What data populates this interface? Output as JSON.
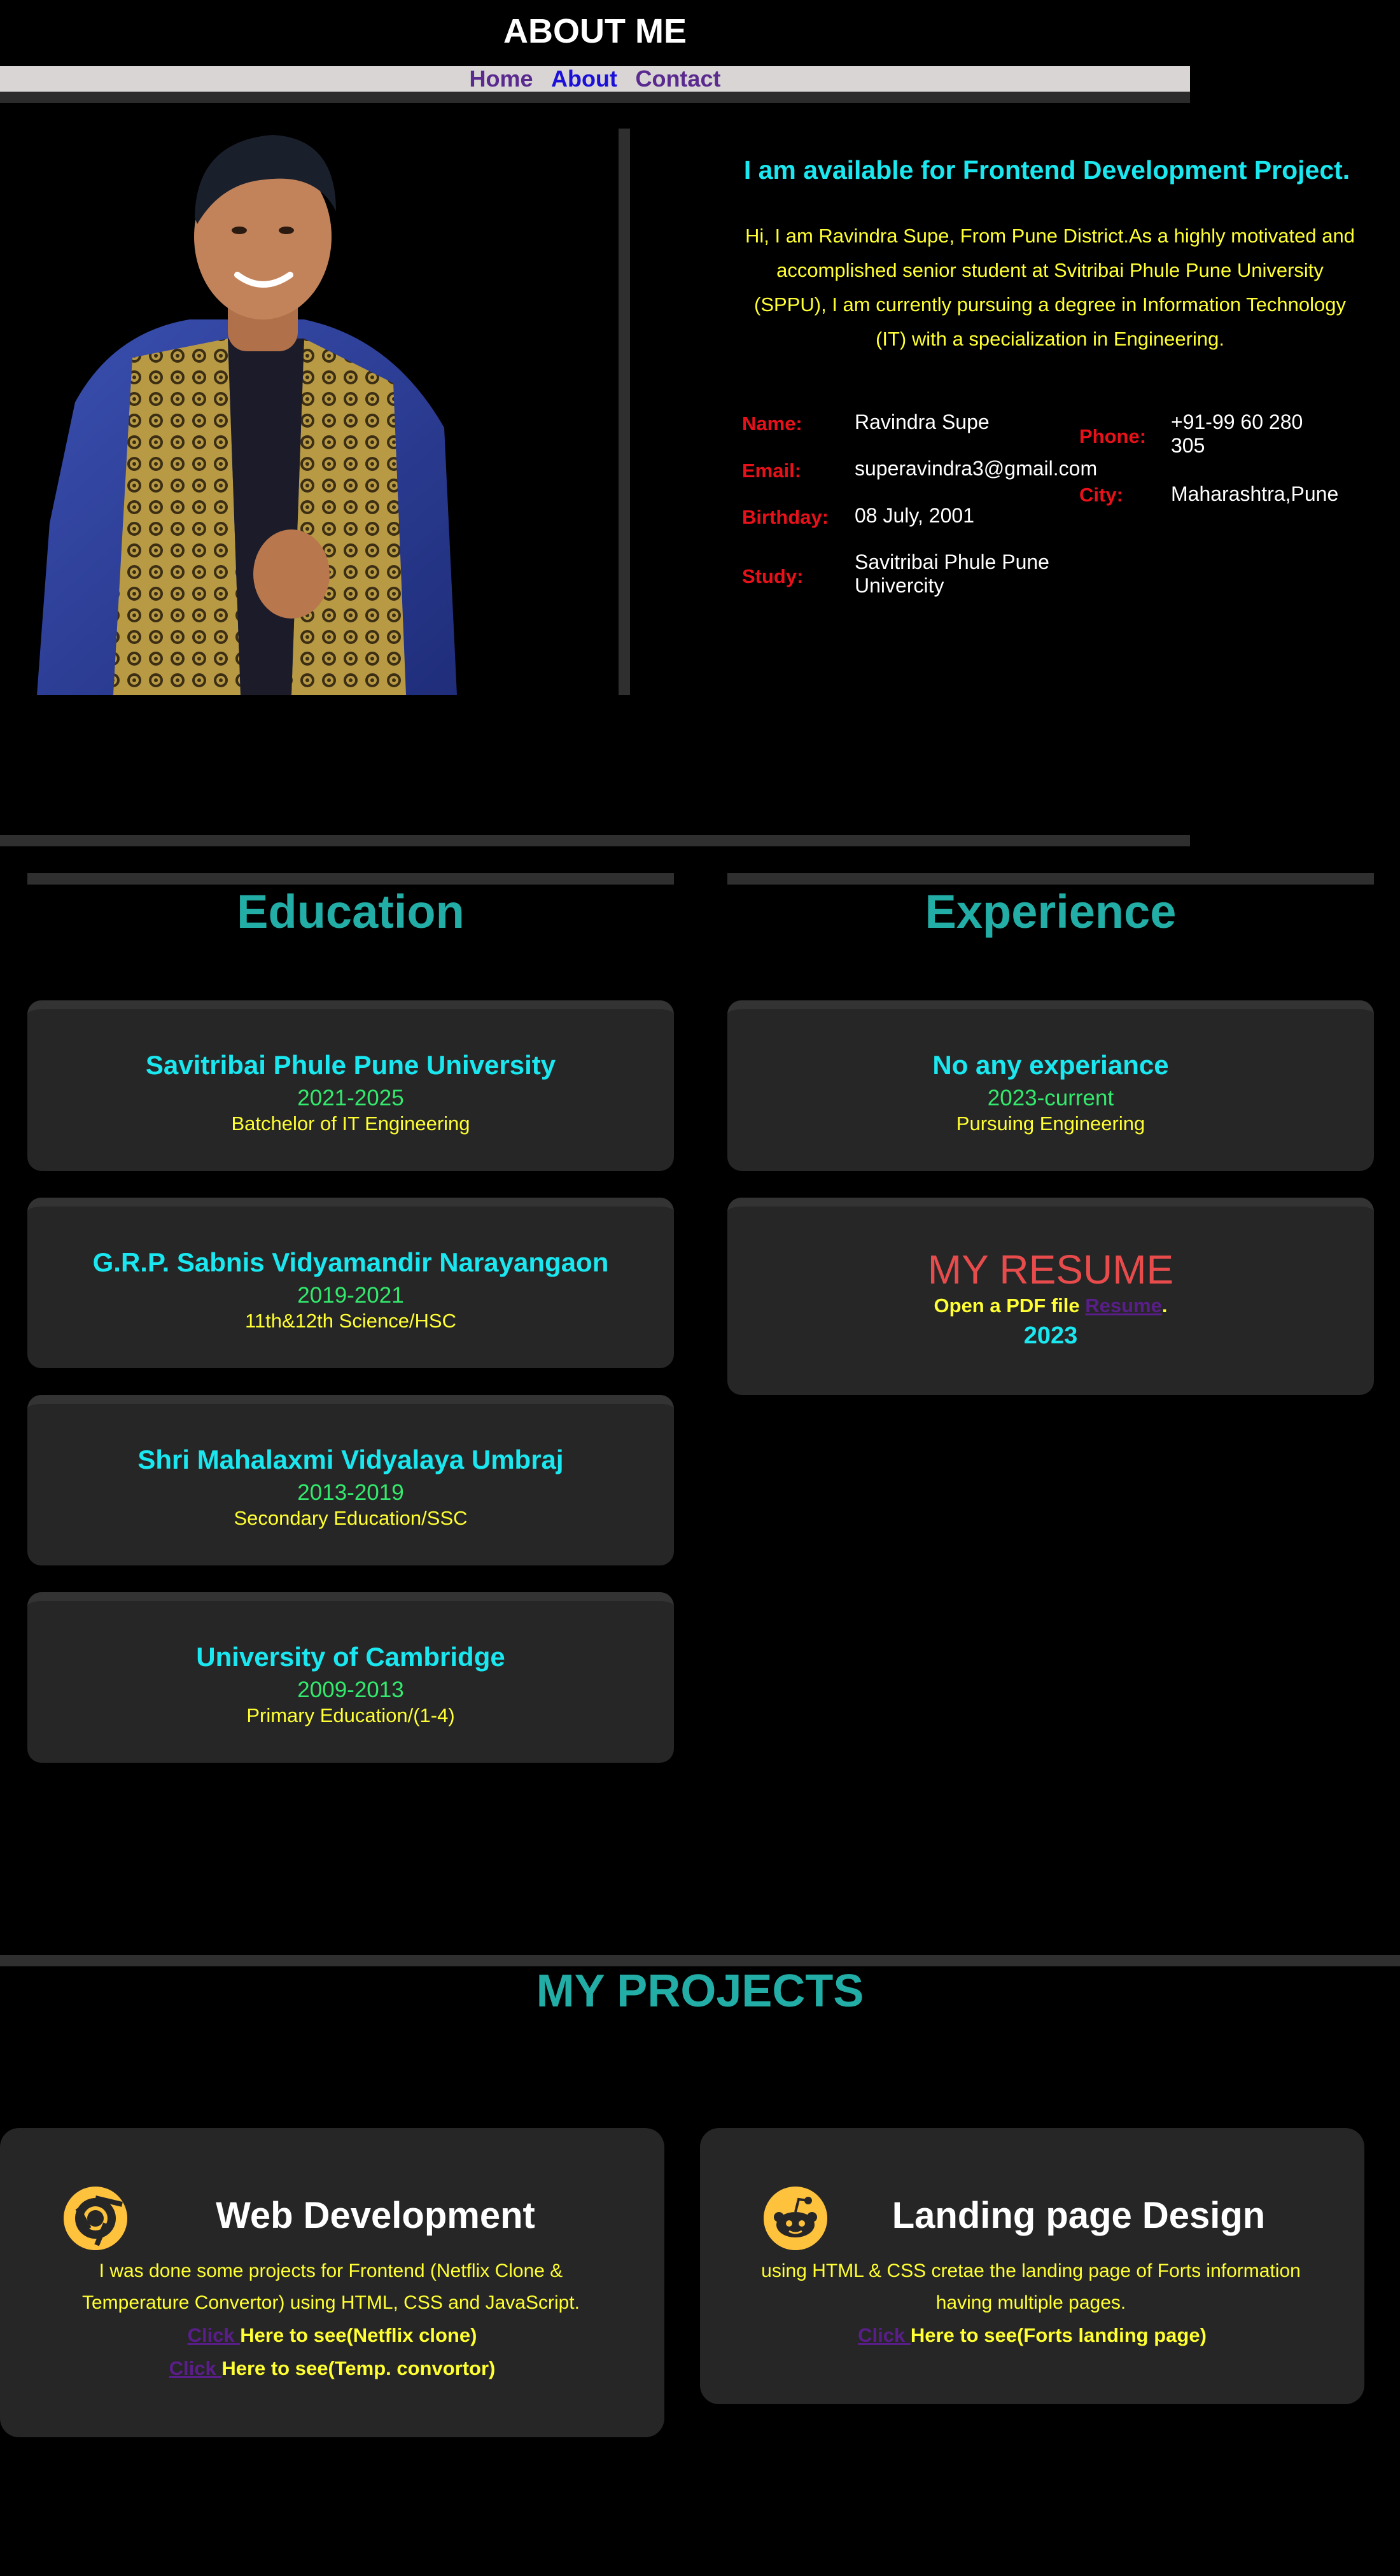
{
  "header": {
    "title": "ABOUT ME"
  },
  "nav": {
    "home": "Home",
    "about": "About",
    "contact": "Contact"
  },
  "about": {
    "headline": "I am available for Frontend Development Project.",
    "intro": "Hi, I am Ravindra Supe, From Pune District.As a highly motivated and accomplished senior student at Svitribai Phule Pune University (SPPU), I am currently pursuing a degree in Information Technology (IT) with a specialization in Engineering.",
    "name_label": "Name:",
    "name": "Ravindra Supe",
    "email_label": "Email:",
    "email": "superavindra3@gmail.com",
    "birthday_label": "Birthday:",
    "birthday": "08 July, 2001",
    "study_label": "Study:",
    "study": "Savitribai Phule Pune Univercity",
    "phone_label": "Phone:",
    "phone": "+91-99 60 280 305",
    "city_label": "City:",
    "city": "Maharashtra,Pune"
  },
  "education": {
    "title": "Education",
    "items": [
      {
        "school": "Savitribai Phule Pune University",
        "years": "2021-2025",
        "desc": "Batchelor of IT Engineering"
      },
      {
        "school": "G.R.P. Sabnis Vidyamandir Narayangaon",
        "years": "2019-2021",
        "desc": "11th&12th Science/HSC"
      },
      {
        "school": "Shri Mahalaxmi Vidyalaya Umbraj",
        "years": "2013-2019",
        "desc": "Secondary Education/SSC"
      },
      {
        "school": "University of Cambridge",
        "years": "2009-2013",
        "desc": "Primary Education/(1-4)"
      }
    ]
  },
  "experience": {
    "title": "Experience",
    "item": {
      "title": "No any experiance",
      "years": "2023-current",
      "desc": "Pursuing Engineering"
    },
    "resume": {
      "title": "MY RESUME",
      "text_before": "Open a PDF file ",
      "link": "Resume",
      "text_after": ".",
      "year": "2023"
    }
  },
  "projects": {
    "title": "MY PROJECTS",
    "web": {
      "icon": "chrome-icon",
      "title": "Web Development",
      "desc": "I was done some projects for Frontend (Netflix Clone & Temperature Convertor) using HTML, CSS and JavaScript.",
      "link1": "Click ",
      "link1_text": "Here to see(Netflix clone)",
      "link2": "Click ",
      "link2_text": "Here to see(Temp. convortor)"
    },
    "landing": {
      "icon": "reddit-icon",
      "title": "Landing page Design",
      "desc": "using HTML & CSS cretae the landing page of Forts information having multiple pages.",
      "link1": "Click ",
      "link1_text": "Here to see(Forts landing page)"
    }
  },
  "colors": {
    "nav_home": "#5a2a8e",
    "nav_about": "#1a10d8",
    "nav_contact": "#5a2a8e"
  }
}
